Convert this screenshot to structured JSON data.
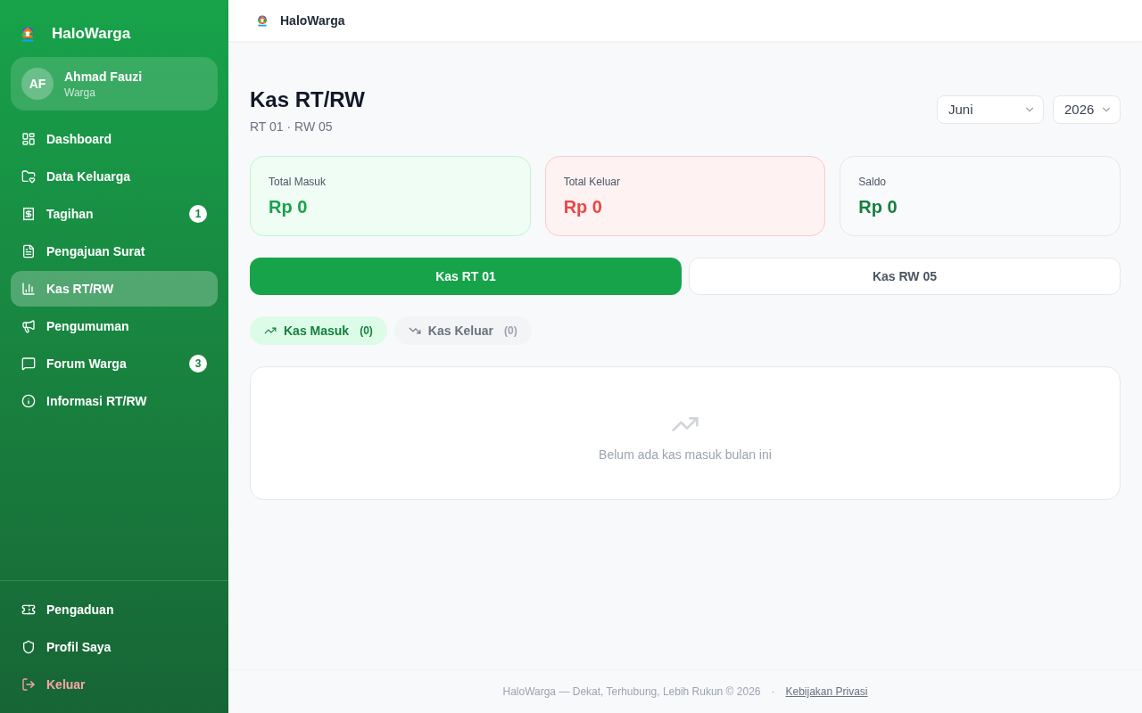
{
  "sidebar": {
    "brand": "HaloWarga",
    "user": {
      "initials": "AF",
      "name": "Ahmad Fauzi",
      "role": "Warga"
    },
    "nav_items": [
      {
        "label": "Dashboard",
        "selected": false
      },
      {
        "label": "Data Keluarga",
        "selected": false
      },
      {
        "label": "Tagihan",
        "selected": false,
        "badge": "1"
      },
      {
        "label": "Pengajuan Surat",
        "selected": false
      },
      {
        "label": "Kas RT/RW",
        "selected": true
      },
      {
        "label": "Pengumuman",
        "selected": false
      },
      {
        "label": "Forum Warga",
        "selected": false,
        "badge": "3"
      },
      {
        "label": "Informasi RT/RW",
        "selected": false
      }
    ],
    "footer_items": [
      {
        "label": "Pengaduan",
        "kind": "link"
      },
      {
        "label": "Profil Saya",
        "kind": "link"
      },
      {
        "label": "Keluar",
        "kind": "logout"
      }
    ]
  },
  "topbar": {
    "brand": "HaloWarga"
  },
  "page": {
    "title": "Kas RT/RW",
    "subtitle": "RT 01 · RW 05",
    "month_select": {
      "value": "Juni"
    },
    "year_select": {
      "value": "2026"
    }
  },
  "stats": [
    {
      "label": "Total Masuk",
      "value": "Rp 0",
      "kind": "income"
    },
    {
      "label": "Total Keluar",
      "value": "Rp 0",
      "kind": "expense"
    },
    {
      "label": "Saldo",
      "value": "Rp 0",
      "kind": "balance"
    }
  ],
  "fund_tabs": [
    {
      "label": "Kas RT 01",
      "selected": true
    },
    {
      "label": "Kas RW 05",
      "selected": false
    }
  ],
  "flow_tabs": [
    {
      "label": "Kas Masuk",
      "count": "(0)",
      "kind": "in",
      "selected": true
    },
    {
      "label": "Kas Keluar",
      "count": "(0)",
      "kind": "out",
      "selected": false
    }
  ],
  "empty_state": {
    "message": "Belum ada kas masuk bulan ini"
  },
  "footer": {
    "text": "HaloWarga — Dekat, Terhubung, Lebih Rukun © 2026",
    "separator": "·",
    "link": "Kebijakan Privasi"
  }
}
